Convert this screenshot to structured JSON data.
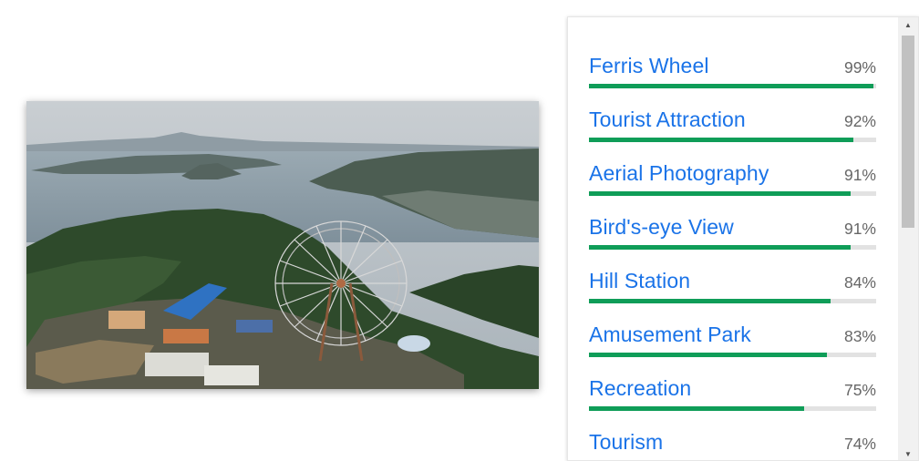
{
  "image": {
    "alt": "Aerial view of a ferris wheel amusement park on a hill overlooking a lake with a volcanic island"
  },
  "labels": [
    {
      "name": "Ferris Wheel",
      "score_text": "99%",
      "score": 0.99
    },
    {
      "name": "Tourist Attraction",
      "score_text": "92%",
      "score": 0.92
    },
    {
      "name": "Aerial Photography",
      "score_text": "91%",
      "score": 0.91
    },
    {
      "name": "Bird's-eye View",
      "score_text": "91%",
      "score": 0.91
    },
    {
      "name": "Hill Station",
      "score_text": "84%",
      "score": 0.84
    },
    {
      "name": "Amusement Park",
      "score_text": "83%",
      "score": 0.83
    },
    {
      "name": "Recreation",
      "score_text": "75%",
      "score": 0.75
    },
    {
      "name": "Tourism",
      "score_text": "74%",
      "score": 0.74
    }
  ],
  "colors": {
    "label_link": "#1a73e8",
    "bar_fill": "#0f9d58",
    "bar_track": "#e2e2e2"
  },
  "icons": {
    "scroll_up": "up-arrow-icon",
    "scroll_down": "down-arrow-icon"
  }
}
